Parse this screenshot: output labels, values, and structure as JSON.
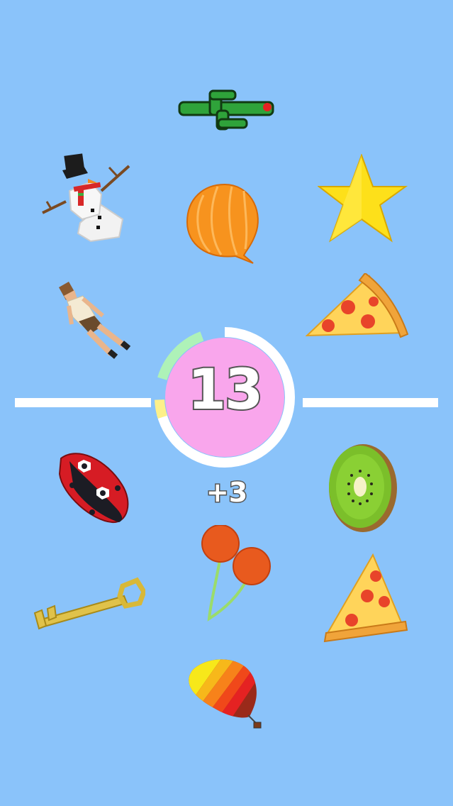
{
  "game": {
    "score": "13",
    "bonus": "+3"
  },
  "colors": {
    "background": "#8ac3fa",
    "center_circle": "#f9a6ec",
    "ring_white": "#ffffff",
    "ring_green": "#aef2b8",
    "ring_yellow": "#fdf08a"
  },
  "top_items": [
    "cactus",
    "snowman",
    "onion",
    "star",
    "woman",
    "pizza-slice"
  ],
  "bottom_items": [
    "ladybug",
    "kiwi",
    "cherries",
    "key",
    "pizza-slice",
    "hot-air-balloon"
  ]
}
